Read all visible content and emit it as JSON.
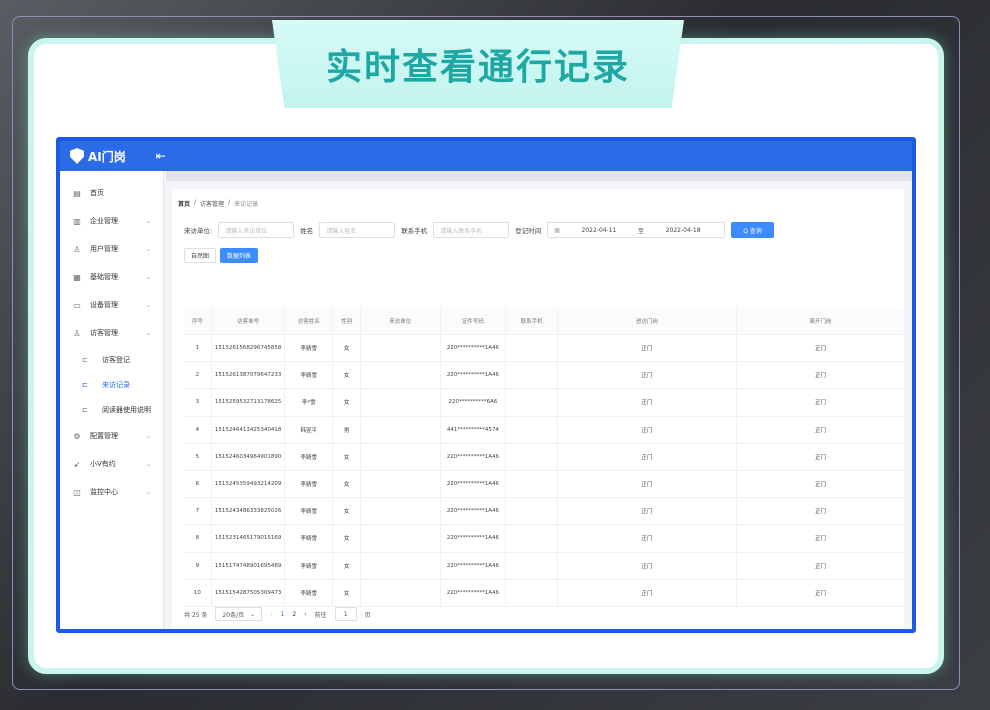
{
  "banner": {
    "title": "实时查看通行记录"
  },
  "app": {
    "logo_text": "AI门岗",
    "collapse_icon": "menu-fold-icon"
  },
  "sidebar": {
    "items": [
      {
        "label": "首页",
        "icon": "home-icon",
        "has_children": false
      },
      {
        "label": "企业管理",
        "icon": "building-icon",
        "has_children": true
      },
      {
        "label": "用户管理",
        "icon": "user-icon",
        "has_children": true
      },
      {
        "label": "基础管理",
        "icon": "calendar-icon",
        "has_children": true
      },
      {
        "label": "设备管理",
        "icon": "device-icon",
        "has_children": true
      },
      {
        "label": "访客管理",
        "icon": "visitor-icon",
        "has_children": true,
        "expanded": true
      }
    ],
    "sub_items": [
      {
        "label": "访客登记",
        "active": false
      },
      {
        "label": "来访记录",
        "active": true
      },
      {
        "label": "阅读器使用说明",
        "active": false
      }
    ],
    "items_after": [
      {
        "label": "配置管理",
        "icon": "settings-icon"
      },
      {
        "label": "小V有约",
        "icon": "send-icon"
      },
      {
        "label": "监控中心",
        "icon": "monitor-icon"
      }
    ]
  },
  "breadcrumb": [
    "首页",
    "访客管理",
    "来访记录"
  ],
  "filter": {
    "unit_label": "来访单位:",
    "unit_placeholder": "请输入来访单位",
    "name_label": "姓名",
    "name_placeholder": "请输入姓名",
    "phone_label": "联系手机",
    "phone_placeholder": "请输入联系手机",
    "time_label": "登记时间",
    "date_start": "2022-04-11",
    "date_sep": "至",
    "date_end": "2022-04-18",
    "query_label": "Q 查询"
  },
  "view_tabs": [
    {
      "label": "自然图",
      "active": false
    },
    {
      "label": "数据列表",
      "active": true
    }
  ],
  "table": {
    "headers": [
      "序号",
      "访客单号",
      "访客姓名",
      "性别",
      "来访单位",
      "证件号码",
      "联系手机",
      "进访门岗",
      "离开门岗"
    ],
    "rows": [
      [
        "1",
        "1515261568296745858",
        "李婧雪",
        "女",
        "",
        "220**********1A46",
        "",
        "正门",
        "正门"
      ],
      [
        "2",
        "1515261387079647233",
        "李婧雪",
        "女",
        "",
        "220**********1A46",
        "",
        "正门",
        "正门"
      ],
      [
        "3",
        "1515259532713178625",
        "李*雪",
        "女",
        "",
        "220**********6A6",
        "",
        "正门",
        "正门"
      ],
      [
        "4",
        "1515246413425340418",
        "韩昱平",
        "男",
        "",
        "441**********4574",
        "",
        "正门",
        "正门"
      ],
      [
        "5",
        "1515246034964901890",
        "李婧雪",
        "女",
        "",
        "220**********1A46",
        "",
        "正门",
        "正门"
      ],
      [
        "6",
        "1515245359493214209",
        "李婧雪",
        "女",
        "",
        "220**********1A46",
        "",
        "正门",
        "正门"
      ],
      [
        "7",
        "1515243486333825026",
        "李婧雪",
        "女",
        "",
        "220**********1A46",
        "",
        "正门",
        "正门"
      ],
      [
        "8",
        "1515231465179015169",
        "李婧雪",
        "女",
        "",
        "220**********1A46",
        "",
        "正门",
        "正门"
      ],
      [
        "9",
        "1515174748901695489",
        "李婧雪",
        "女",
        "",
        "220**********1A46",
        "",
        "正门",
        "正门"
      ],
      [
        "10",
        "1515154287505309473",
        "李婧雪",
        "女",
        "",
        "220**********1A46",
        "",
        "正门",
        "正门"
      ]
    ]
  },
  "pager": {
    "total": "共 25 条",
    "page_size": "20条/页",
    "prev": "‹",
    "pages": [
      "1",
      "2"
    ],
    "active_page": "1",
    "next": "›",
    "goto_label": "前往",
    "goto_value": "1",
    "page_unit": "页"
  }
}
